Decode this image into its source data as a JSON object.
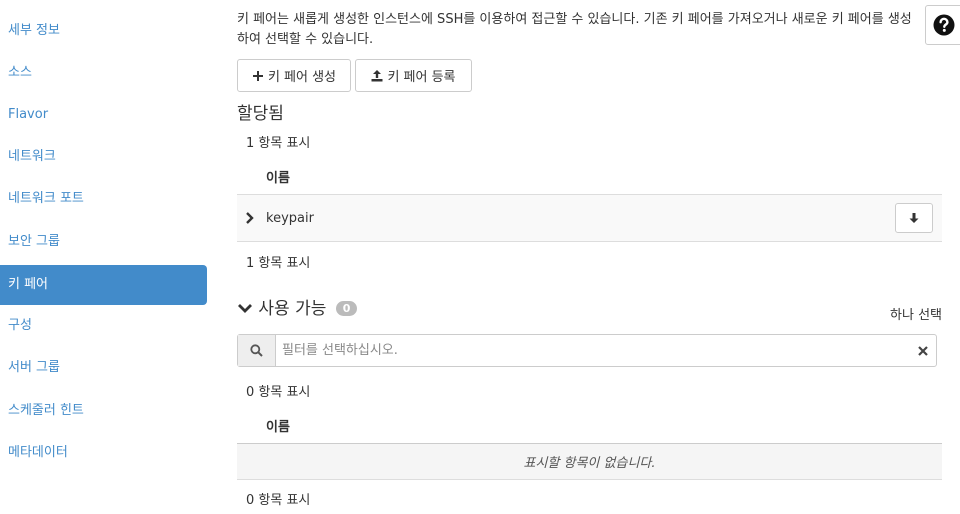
{
  "sidebar": {
    "items": [
      {
        "label": "세부 정보"
      },
      {
        "label": "소스"
      },
      {
        "label": "Flavor"
      },
      {
        "label": "네트워크"
      },
      {
        "label": "네트워크 포트"
      },
      {
        "label": "보안 그룹"
      },
      {
        "label": "키 페어"
      },
      {
        "label": "구성"
      },
      {
        "label": "서버 그룹"
      },
      {
        "label": "스케줄러 힌트"
      },
      {
        "label": "메타데이터"
      }
    ],
    "active_index": 6
  },
  "main": {
    "description": "키 페어는 새롭게 생성한 인스턴스에 SSH를 이용하여 접근할 수 있습니다. 기존 키 페어를 가져오거나 새로운 키 페어를 생성하여 선택할 수 있습니다.",
    "create_button": "키 페어 생성",
    "import_button": "키 페어 등록",
    "allocated": {
      "title": "할당됨",
      "count_top": "1 항목 표시",
      "column_name": "이름",
      "rows": [
        {
          "name": "keypair"
        }
      ],
      "count_bottom": "1 항목 표시"
    },
    "available": {
      "title": "사용 가능",
      "badge": "0",
      "select_one": "하나 선택",
      "filter_placeholder": "필터를 선택하십시오.",
      "count_top": "0 항목 표시",
      "column_name": "이름",
      "empty_message": "표시할 항목이 없습니다.",
      "count_bottom": "0 항목 표시"
    }
  },
  "colors": {
    "accent": "#428bca",
    "link": "#428bca"
  }
}
